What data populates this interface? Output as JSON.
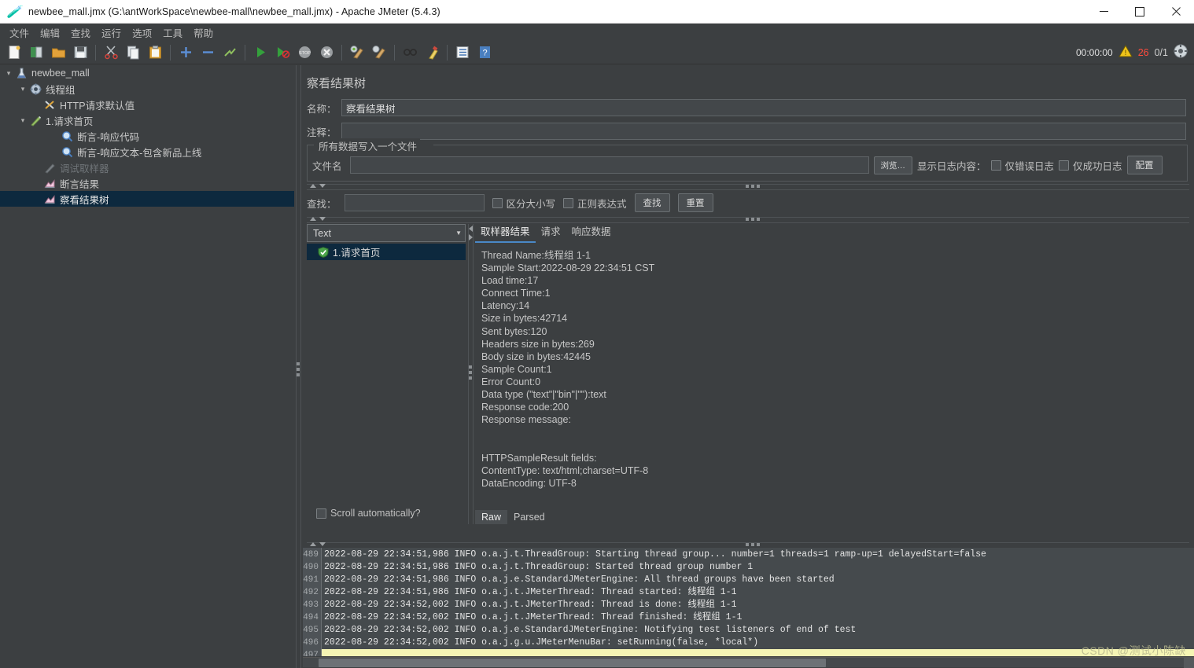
{
  "window": {
    "title": "newbee_mall.jmx (G:\\antWorkSpace\\newbee-mall\\newbee_mall.jmx) - Apache JMeter (5.4.3)",
    "minimize": "–",
    "maximize": "□",
    "close": "✕"
  },
  "menubar": {
    "items": [
      {
        "label": "文件"
      },
      {
        "label": "编辑"
      },
      {
        "label": "查找"
      },
      {
        "label": "运行"
      },
      {
        "label": "选项"
      },
      {
        "label": "工具"
      },
      {
        "label": "帮助"
      }
    ]
  },
  "toolbar": {
    "buttons": [
      {
        "name": "new-icon"
      },
      {
        "name": "templates-icon"
      },
      {
        "name": "open-icon"
      },
      {
        "name": "save-icon"
      },
      {
        "name": "sep"
      },
      {
        "name": "cut-icon"
      },
      {
        "name": "copy-icon"
      },
      {
        "name": "paste-icon"
      },
      {
        "name": "sep"
      },
      {
        "name": "expand-all-icon"
      },
      {
        "name": "collapse-all-icon"
      },
      {
        "name": "toggle-icon"
      },
      {
        "name": "sep"
      },
      {
        "name": "start-icon"
      },
      {
        "name": "start-no-pauses-icon"
      },
      {
        "name": "stop-icon"
      },
      {
        "name": "shutdown-icon"
      },
      {
        "name": "sep"
      },
      {
        "name": "clear-icon"
      },
      {
        "name": "clear-all-icon"
      },
      {
        "name": "sep"
      },
      {
        "name": "search-icon"
      },
      {
        "name": "search-reset-icon"
      },
      {
        "name": "sep"
      },
      {
        "name": "function-helper-icon"
      },
      {
        "name": "help-icon"
      }
    ],
    "elapsed_time": "00:00:00",
    "warning_count": "26",
    "thread_counter": "0/1"
  },
  "tree": {
    "nodes": [
      {
        "label": "newbee_mall",
        "indent": 0,
        "icon": "jmeter-plan-icon",
        "twisty": "down",
        "selected": false,
        "disabled": false
      },
      {
        "label": "线程组",
        "indent": 1,
        "icon": "thread-group-icon",
        "twisty": "down",
        "selected": false,
        "disabled": false
      },
      {
        "label": "HTTP请求默认值",
        "indent": 2,
        "icon": "config-defaults-icon",
        "twisty": "none",
        "selected": false,
        "disabled": false
      },
      {
        "label": "1.请求首页",
        "indent": 2,
        "icon": "http-sampler-icon",
        "twisty": "down",
        "selected": false,
        "disabled": false
      },
      {
        "label": "断言-响应代码",
        "indent": 3,
        "icon": "assertion-icon",
        "twisty": "none",
        "selected": false,
        "disabled": false
      },
      {
        "label": "断言-响应文本-包含新品上线",
        "indent": 3,
        "icon": "assertion-icon",
        "twisty": "none",
        "selected": false,
        "disabled": false
      },
      {
        "label": "调试取样器",
        "indent": 2,
        "icon": "debug-sampler-icon",
        "twisty": "none",
        "selected": false,
        "disabled": true
      },
      {
        "label": "断言结果",
        "indent": 2,
        "icon": "listener-icon",
        "twisty": "none",
        "selected": false,
        "disabled": false
      },
      {
        "label": "察看结果树",
        "indent": 2,
        "icon": "listener-icon",
        "twisty": "none",
        "selected": true,
        "disabled": false
      }
    ]
  },
  "panel": {
    "title": "察看结果树",
    "name_label": "名称：",
    "name_value": "察看结果树",
    "comment_label": "注释：",
    "comment_value": "",
    "fileset_legend": "所有数据写入一个文件",
    "filename_label": "文件名",
    "filename_value": "",
    "browse_button": "浏览…",
    "log_display_label": "显示日志内容：",
    "errors_only_label": "仅错误日志",
    "success_only_label": "仅成功日志",
    "configure_button": "配置"
  },
  "search": {
    "label": "查找：",
    "value": "",
    "case_sensitive_label": "区分大小写",
    "regex_label": "正则表达式",
    "search_button": "查找",
    "reset_button": "重置"
  },
  "results": {
    "renderer_selected": "Text",
    "items": [
      {
        "label": "1.请求首页",
        "status": "success"
      }
    ],
    "scroll_auto_label": "Scroll automatically?",
    "tabs": [
      {
        "label": "取样器结果",
        "active": true
      },
      {
        "label": "请求",
        "active": false
      },
      {
        "label": "响应数据",
        "active": false
      }
    ],
    "sampler_result_lines": [
      "Thread Name:线程组 1-1",
      "Sample Start:2022-08-29 22:34:51 CST",
      "Load time:17",
      "Connect Time:1",
      "Latency:14",
      "Size in bytes:42714",
      "Sent bytes:120",
      "Headers size in bytes:269",
      "Body size in bytes:42445",
      "Sample Count:1",
      "Error Count:0",
      "Data type (\"text\"|\"bin\"|\"\"):text",
      "Response code:200",
      "Response message:",
      "",
      "",
      "HTTPSampleResult fields:",
      "ContentType: text/html;charset=UTF-8",
      "DataEncoding: UTF-8"
    ],
    "raw_tabs": [
      {
        "label": "Raw",
        "active": true
      },
      {
        "label": "Parsed",
        "active": false
      }
    ]
  },
  "log_console": {
    "lines": [
      {
        "num": "489",
        "text": "2022-08-29 22:34:51,986 INFO o.a.j.t.ThreadGroup: Starting thread group... number=1 threads=1 ramp-up=1 delayedStart=false",
        "highlight": false
      },
      {
        "num": "490",
        "text": "2022-08-29 22:34:51,986 INFO o.a.j.t.ThreadGroup: Started thread group number 1",
        "highlight": false
      },
      {
        "num": "491",
        "text": "2022-08-29 22:34:51,986 INFO o.a.j.e.StandardJMeterEngine: All thread groups have been started",
        "highlight": false
      },
      {
        "num": "492",
        "text": "2022-08-29 22:34:51,986 INFO o.a.j.t.JMeterThread: Thread started: 线程组 1-1",
        "highlight": false
      },
      {
        "num": "493",
        "text": "2022-08-29 22:34:52,002 INFO o.a.j.t.JMeterThread: Thread is done: 线程组 1-1",
        "highlight": false
      },
      {
        "num": "494",
        "text": "2022-08-29 22:34:52,002 INFO o.a.j.t.JMeterThread: Thread finished: 线程组 1-1",
        "highlight": false
      },
      {
        "num": "495",
        "text": "2022-08-29 22:34:52,002 INFO o.a.j.e.StandardJMeterEngine: Notifying test listeners of end of test",
        "highlight": false
      },
      {
        "num": "496",
        "text": "2022-08-29 22:34:52,002 INFO o.a.j.g.u.JMeterMenuBar: setRunning(false, *local*)",
        "highlight": false
      },
      {
        "num": "497",
        "text": "",
        "highlight": true
      }
    ]
  },
  "watermark": "CSDN @测试小陈缺",
  "colors": {
    "background": "#3c3f41",
    "selection": "#0d293e",
    "accent": "#4a88c7",
    "error": "#ff4b3e",
    "highlight": "#f5f5b4"
  }
}
